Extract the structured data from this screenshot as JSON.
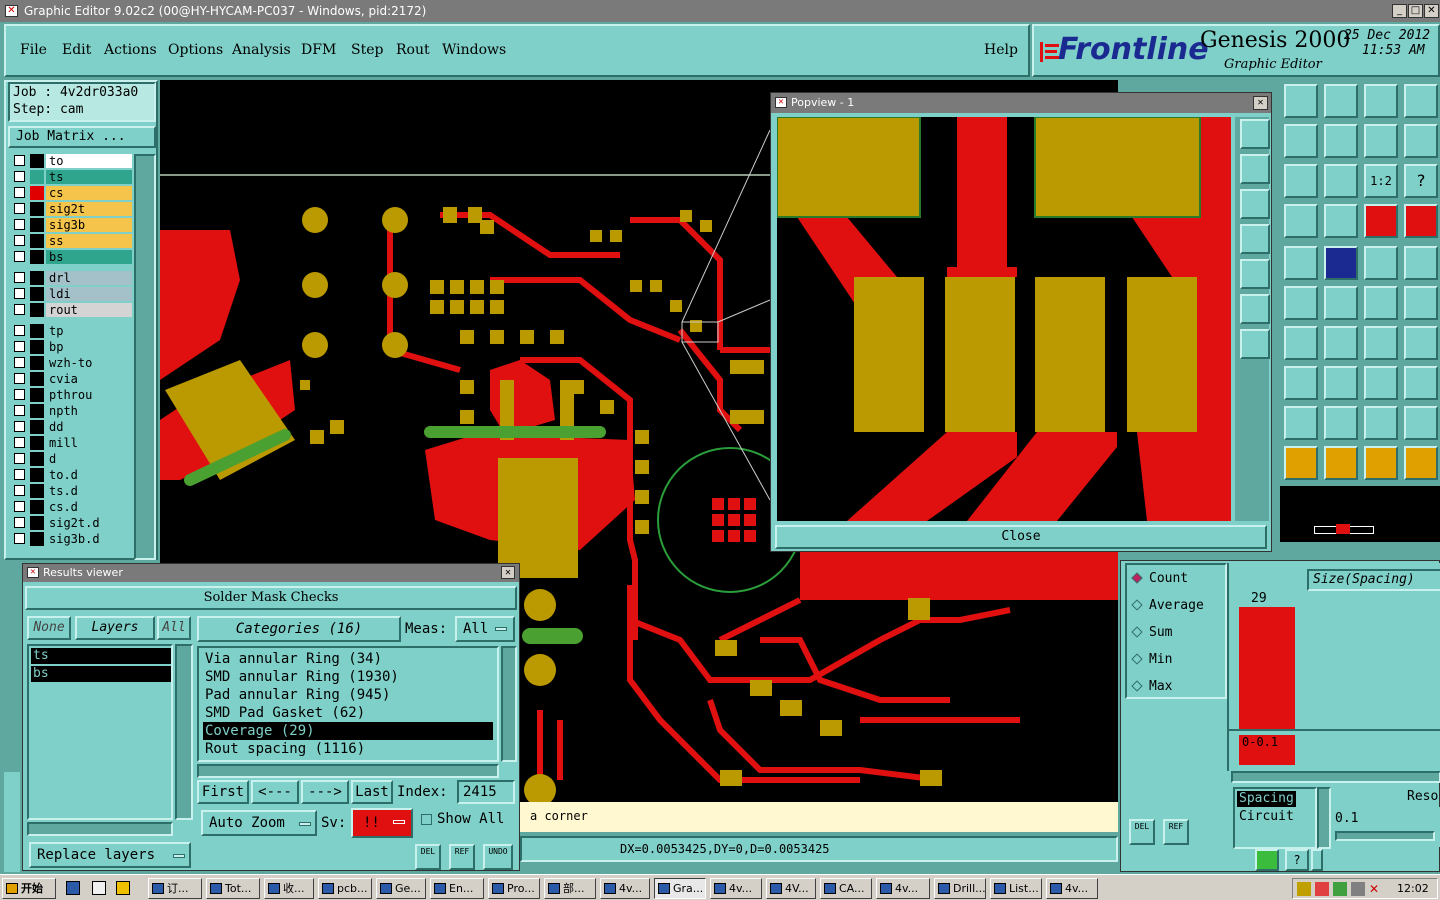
{
  "window": {
    "title": "Graphic Editor 9.02c2 (00@HY-HYCAM-PC037 - Windows, pid:2172)"
  },
  "menu": {
    "file": "File",
    "edit": "Edit",
    "actions": "Actions",
    "options": "Options",
    "analysis": "Analysis",
    "dfm": "DFM",
    "step": "Step",
    "rout": "Rout",
    "windows": "Windows",
    "help": "Help"
  },
  "brand": {
    "logo": "Frontline",
    "product": "Genesis 2000",
    "subtitle": "Graphic Editor",
    "date": "25 Dec 2012",
    "time": "11:53 AM"
  },
  "job": {
    "job_line": "Job : 4v2dr033a0",
    "step_line": "Step: cam",
    "matrix_button": "Job Matrix ..."
  },
  "layers": [
    {
      "name": "to",
      "color": "#ffffff",
      "swatch": "#000000"
    },
    {
      "name": "ts",
      "color": "#2fa58e",
      "swatch": "#2fa58e"
    },
    {
      "name": "cs",
      "color": "#f5c44a",
      "swatch": "#e00000"
    },
    {
      "name": "sig2t",
      "color": "#f5c44a",
      "swatch": "#000000"
    },
    {
      "name": "sig3b",
      "color": "#f5c44a",
      "swatch": "#000000"
    },
    {
      "name": "ss",
      "color": "#f5c44a",
      "swatch": "#000000"
    },
    {
      "name": "bs",
      "color": "#2fa58e",
      "swatch": "#000000"
    },
    {
      "name": "drl",
      "color": "#a4c0c8",
      "swatch": "#000000"
    },
    {
      "name": "ldi",
      "color": "#a4c0c8",
      "swatch": "#000000"
    },
    {
      "name": "rout",
      "color": "#d4d4d4",
      "swatch": "#000000"
    },
    {
      "name": "tp",
      "color": "#7fd0c8",
      "swatch": "#000000"
    },
    {
      "name": "bp",
      "color": "#7fd0c8",
      "swatch": "#000000"
    },
    {
      "name": "wzh-to",
      "color": "#7fd0c8",
      "swatch": "#000000"
    },
    {
      "name": "cvia",
      "color": "#7fd0c8",
      "swatch": "#000000"
    },
    {
      "name": "pthrou",
      "color": "#7fd0c8",
      "swatch": "#000000"
    },
    {
      "name": "npth",
      "color": "#7fd0c8",
      "swatch": "#000000"
    },
    {
      "name": "dd",
      "color": "#7fd0c8",
      "swatch": "#000000"
    },
    {
      "name": "mill",
      "color": "#7fd0c8",
      "swatch": "#000000"
    },
    {
      "name": "d",
      "color": "#7fd0c8",
      "swatch": "#000000"
    },
    {
      "name": "to.d",
      "color": "#7fd0c8",
      "swatch": "#000000"
    },
    {
      "name": "ts.d",
      "color": "#7fd0c8",
      "swatch": "#000000"
    },
    {
      "name": "cs.d",
      "color": "#7fd0c8",
      "swatch": "#000000"
    },
    {
      "name": "sig2t.d",
      "color": "#7fd0c8",
      "swatch": "#000000"
    },
    {
      "name": "sig3b.d",
      "color": "#7fd0c8",
      "swatch": "#000000"
    }
  ],
  "popview": {
    "title": "Popview - 1",
    "close": "Close"
  },
  "results": {
    "title": "Results viewer",
    "section": "Solder Mask Checks",
    "none": "None",
    "layers": "Layers",
    "all": "All",
    "categories_label": "Categories (16)",
    "meas_label": "Meas:",
    "meas_value": "All",
    "layer_list": [
      "ts",
      "bs"
    ],
    "categories": [
      "Via annular Ring (34)",
      "SMD annular Ring (1930)",
      "Pad annular Ring (945)",
      "SMD Pad Gasket (62)",
      "Coverage (29)",
      "Rout spacing (1116)"
    ],
    "selected_index": 4,
    "first": "First",
    "prev": "<---",
    "next": "--->",
    "last": "Last",
    "index_label": "Index:",
    "index_value": "2415",
    "auto_zoom": "Auto Zoom",
    "sv_label": "Sv:",
    "sv_value": "!!",
    "show_all": "Show All",
    "replace_layers": "Replace layers",
    "del": "DEL",
    "ref": "REF",
    "undo": "UNDO"
  },
  "status": {
    "message": "a corner",
    "coords": "DX=0.0053425,DY=0,D=0.0053425"
  },
  "histogram": {
    "options": [
      "Count",
      "Average",
      "Sum",
      "Min",
      "Max"
    ],
    "selected": "Count",
    "header": "Size(Spacing)",
    "bar_value": "29",
    "bar_label": "0-0.1",
    "type_items": [
      "Spacing",
      "Circuit"
    ],
    "resolution_label": "Reso",
    "resolution_value": "0.1",
    "del": "DEL",
    "ref": "REF"
  },
  "taskbar": {
    "start": "开始",
    "tasks": [
      "订...",
      "Tot...",
      "收...",
      "pcb...",
      "Ge...",
      "En...",
      "Pro...",
      "部...",
      "4v...",
      "Gra...",
      "4v...",
      "4V...",
      "CA...",
      "4v...",
      "Drill...",
      "List...",
      "4v..."
    ],
    "clock": "12:02"
  }
}
